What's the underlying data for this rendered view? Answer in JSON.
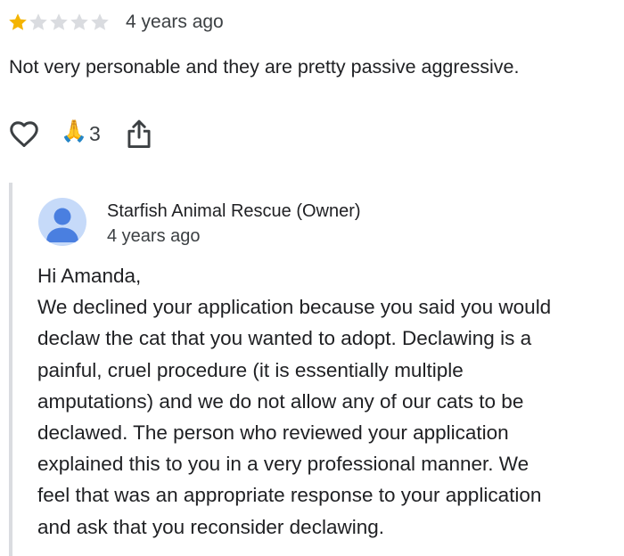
{
  "review": {
    "rating": 1,
    "max_rating": 5,
    "colors": {
      "star_filled": "#f4b400",
      "star_empty": "#dadce0"
    },
    "time": "4 years ago",
    "text": "Not very personable and they are pretty passive aggressive."
  },
  "actions": {
    "like_icon": "heart-outline-icon",
    "reaction_icon": "folded-hands-emoji",
    "reaction_emoji": "🙏",
    "reaction_count": "3",
    "share_icon": "share-icon"
  },
  "owner_reply": {
    "avatar_icon": "person-avatar-icon",
    "avatar_color": "#c6daf9",
    "avatar_figure_color": "#4a7fe0",
    "name": "Starfish Animal Rescue (Owner)",
    "time": "4 years ago",
    "lines": [
      "Hi Amanda,",
      "We declined your application because you said you would",
      "declaw the cat that you wanted to adopt. Declawing is a",
      "painful, cruel procedure (it is essentially multiple",
      "amputations) and we do not allow any of our cats to be",
      "declawed. The person who reviewed your application",
      "explained this to you in a very professional manner. We",
      "feel that was an appropriate response to your application",
      "and ask that you reconsider declawing."
    ]
  }
}
